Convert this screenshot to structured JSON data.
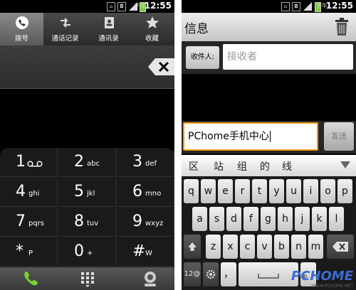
{
  "status_bar": {
    "ampm": "下午",
    "time": "12:55"
  },
  "dialer": {
    "tabs": [
      {
        "label": "拨号",
        "icon": "phone-icon",
        "active": true
      },
      {
        "label": "通话记录",
        "icon": "call-log-icon",
        "active": false
      },
      {
        "label": "通讯录",
        "icon": "contacts-icon",
        "active": false
      },
      {
        "label": "收藏",
        "icon": "star-icon",
        "active": false
      }
    ],
    "keys": [
      {
        "num": "1",
        "letters": "ꝏ",
        "icon": "voicemail-icon"
      },
      {
        "num": "2",
        "letters": "abc"
      },
      {
        "num": "3",
        "letters": "def"
      },
      {
        "num": "4",
        "letters": "ghi"
      },
      {
        "num": "5",
        "letters": "jkl"
      },
      {
        "num": "6",
        "letters": "mno"
      },
      {
        "num": "7",
        "letters": "pqrs"
      },
      {
        "num": "8",
        "letters": "tuv"
      },
      {
        "num": "9",
        "letters": "wxyz"
      },
      {
        "num": "*",
        "letters": "P"
      },
      {
        "num": "0",
        "letters": "+"
      },
      {
        "num": "#",
        "letters": "W"
      }
    ],
    "bottom_icons": [
      "call-icon",
      "dialpad-icon",
      "voicemail-button-icon"
    ]
  },
  "messaging": {
    "title": "信息",
    "recipient_label": "收件人:",
    "recipient_placeholder": "接收者",
    "message_value": "PChome手机中心",
    "send_label": "发送",
    "candidates": [
      "区",
      "站",
      "组",
      "的",
      "线"
    ],
    "keyboard_rows": [
      [
        "q",
        "w",
        "e",
        "r",
        "t",
        "y",
        "u",
        "i",
        "o",
        "p"
      ],
      [
        "a",
        "s",
        "d",
        "f",
        "g",
        "h",
        "j",
        "k",
        "l"
      ],
      [
        "z",
        "x",
        "c",
        "v",
        "b",
        "n",
        "m"
      ]
    ],
    "special_keys": {
      "numeric": "12@",
      "comma": "，",
      "period": "。"
    }
  },
  "watermark": {
    "brand": "PCHOME",
    "url": "WWW.PCHOME.NET"
  },
  "colors": {
    "accent_orange": "#f39c12",
    "call_green": "#7ad134",
    "brand_blue": "#3a6ad6"
  }
}
